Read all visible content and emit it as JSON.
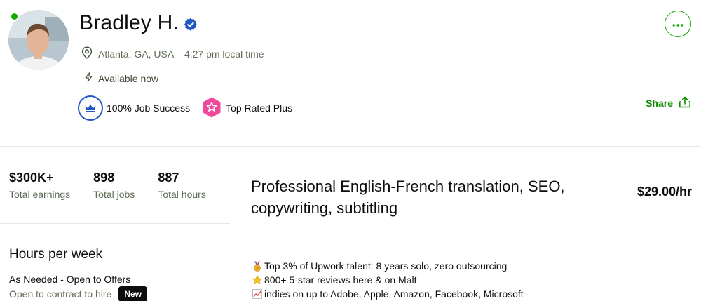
{
  "profile": {
    "name": "Bradley H.",
    "location": "Atlanta, GA, USA – 4:27 pm local time",
    "availability": "Available now",
    "badges": [
      {
        "label": "100% Job Success",
        "icon": "crown-icon"
      },
      {
        "label": "Top Rated Plus",
        "icon": "star-hexagon-icon"
      }
    ],
    "share_label": "Share"
  },
  "stats": [
    {
      "value": "$300K+",
      "label": "Total earnings"
    },
    {
      "value": "898",
      "label": "Total jobs"
    },
    {
      "value": "887",
      "label": "Total hours"
    }
  ],
  "hours": {
    "title": "Hours per week",
    "value": "As Needed - Open to Offers",
    "contract_text": "Open to contract to hire",
    "new_badge": "New"
  },
  "job": {
    "title": "Professional English-French translation, SEO, copywriting, subtitling",
    "rate": "$29.00/hr"
  },
  "overview": [
    {
      "icon": "medal-icon",
      "text": "Top 3% of Upwork talent: 8 years solo, zero outsourcing"
    },
    {
      "icon": "star-icon",
      "text": "800+ 5-star reviews here & on Malt"
    },
    {
      "icon": "chart-icon",
      "text": "indies on up to Adobe, Apple, Amazon, Facebook, Microsoft"
    }
  ],
  "colors": {
    "accent_green": "#14a800",
    "link_green": "#108a00",
    "badge_blue": "#1f57c3",
    "top_rated_pink": "#f0489a"
  }
}
